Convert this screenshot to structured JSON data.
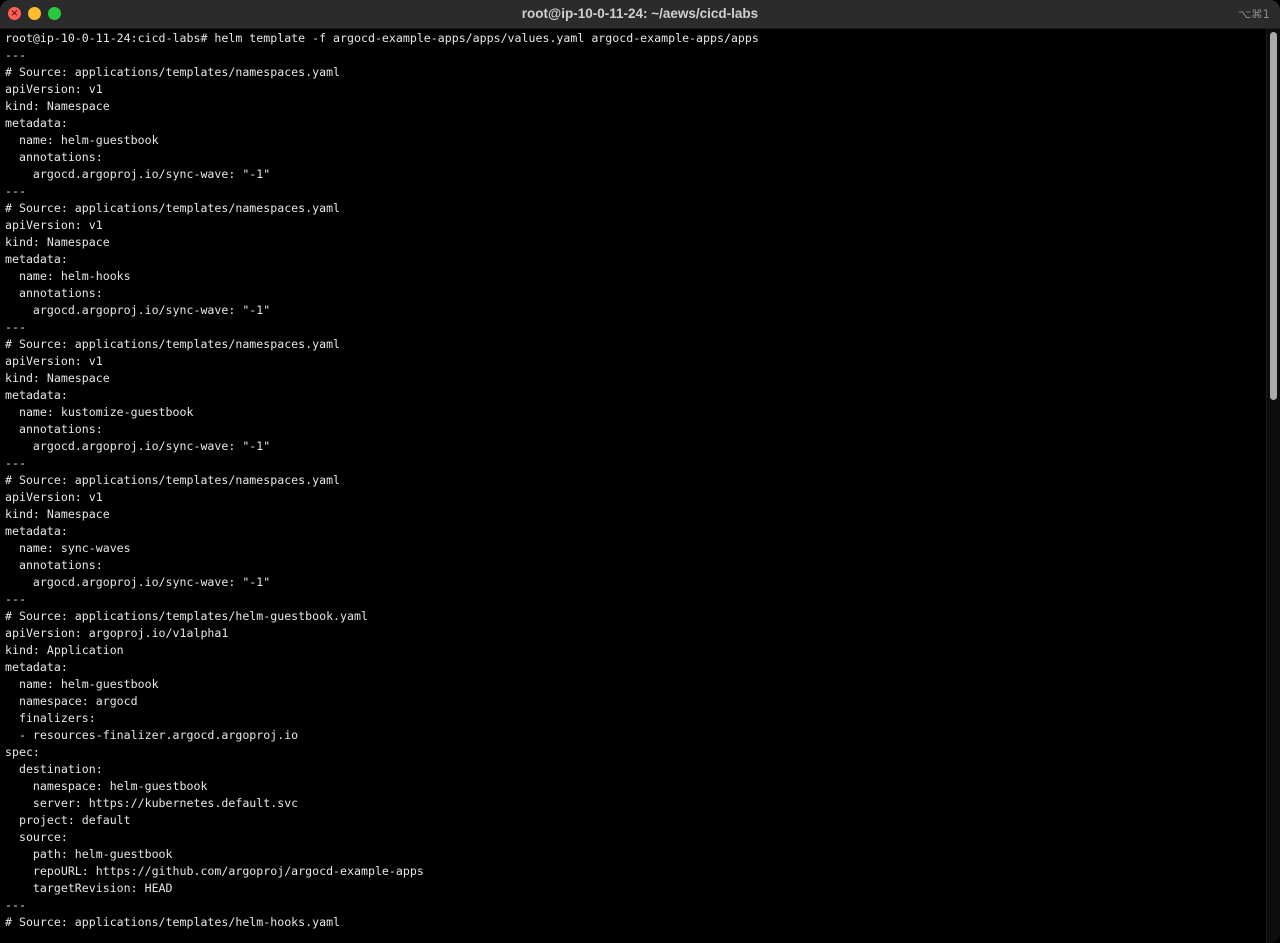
{
  "window": {
    "title": "root@ip-10-0-11-24: ~/aews/cicd-labs",
    "shortcut": "⌥⌘1"
  },
  "terminal": {
    "lines": [
      "root@ip-10-0-11-24:cicd-labs# helm template -f argocd-example-apps/apps/values.yaml argocd-example-apps/apps",
      "---",
      "# Source: applications/templates/namespaces.yaml",
      "apiVersion: v1",
      "kind: Namespace",
      "metadata:",
      "  name: helm-guestbook",
      "  annotations:",
      "    argocd.argoproj.io/sync-wave: \"-1\"",
      "---",
      "# Source: applications/templates/namespaces.yaml",
      "apiVersion: v1",
      "kind: Namespace",
      "metadata:",
      "  name: helm-hooks",
      "  annotations:",
      "    argocd.argoproj.io/sync-wave: \"-1\"",
      "---",
      "# Source: applications/templates/namespaces.yaml",
      "apiVersion: v1",
      "kind: Namespace",
      "metadata:",
      "  name: kustomize-guestbook",
      "  annotations:",
      "    argocd.argoproj.io/sync-wave: \"-1\"",
      "---",
      "# Source: applications/templates/namespaces.yaml",
      "apiVersion: v1",
      "kind: Namespace",
      "metadata:",
      "  name: sync-waves",
      "  annotations:",
      "    argocd.argoproj.io/sync-wave: \"-1\"",
      "---",
      "# Source: applications/templates/helm-guestbook.yaml",
      "apiVersion: argoproj.io/v1alpha1",
      "kind: Application",
      "metadata:",
      "  name: helm-guestbook",
      "  namespace: argocd",
      "  finalizers:",
      "  - resources-finalizer.argocd.argoproj.io",
      "spec:",
      "  destination:",
      "    namespace: helm-guestbook",
      "    server: https://kubernetes.default.svc",
      "  project: default",
      "  source:",
      "    path: helm-guestbook",
      "    repoURL: https://github.com/argoproj/argocd-example-apps",
      "    targetRevision: HEAD",
      "---",
      "# Source: applications/templates/helm-hooks.yaml"
    ]
  },
  "colors": {
    "background": "#000000",
    "text": "#e6e6e6",
    "titlebar": "#2b2b2b",
    "close": "#ff5f57",
    "minimize": "#febc2e",
    "maximize": "#28c840"
  }
}
